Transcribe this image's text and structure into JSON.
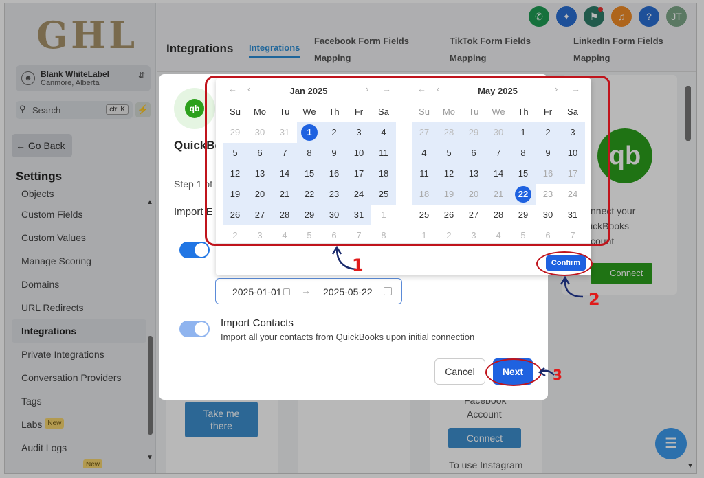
{
  "sidebar": {
    "logo": "GHL",
    "account_name": "Blank WhiteLabel",
    "account_location": "Canmore, Alberta",
    "search_label": "Search",
    "search_shortcut": "ctrl K",
    "go_back": "Go Back",
    "settings_title": "Settings",
    "items": [
      {
        "label": "Objects"
      },
      {
        "label": "Custom Fields"
      },
      {
        "label": "Custom Values"
      },
      {
        "label": "Manage Scoring"
      },
      {
        "label": "Domains"
      },
      {
        "label": "URL Redirects"
      },
      {
        "label": "Integrations"
      },
      {
        "label": "Private Integrations"
      },
      {
        "label": "Conversation Providers"
      },
      {
        "label": "Tags"
      },
      {
        "label": "Labs",
        "badge": "New"
      },
      {
        "label": "Audit Logs"
      }
    ],
    "bottom_badge": "New"
  },
  "header": {
    "title": "Integrations",
    "tabs": [
      {
        "label": "Integrations"
      },
      {
        "label_line1": "Facebook Form Fields",
        "label_line2": "Mapping"
      },
      {
        "label_line1": "TikTok Form Fields",
        "label_line2": "Mapping"
      },
      {
        "label_line1": "LinkedIn Form Fields",
        "label_line2": "Mapping"
      }
    ],
    "avatar_initials": "JT",
    "help_glyph": "?",
    "icons": [
      "phone-icon",
      "sparkle-icon",
      "megaphone-icon",
      "bell-icon",
      "help-icon",
      "avatar"
    ]
  },
  "background": {
    "qb_text_1": "nnect your",
    "qb_text_2": "ickBooks",
    "qb_text_3": "count",
    "connect_label": "Connect",
    "take_me_1": "Take me",
    "take_me_2": "there",
    "fb_text_1": "Facebook",
    "fb_text_2": "Account",
    "connect_label_2": "Connect",
    "instagram_text": "To use Instagram"
  },
  "modal": {
    "title": "QuickBo",
    "step": "Step 1 of",
    "import_label": "Import E",
    "date_start": "2025-01-01",
    "date_end": "2025-05-22",
    "import_contacts_title": "Import Contacts",
    "import_contacts_desc": "Import all your contacts from QuickBooks upon initial connection",
    "cancel": "Cancel",
    "next": "Next"
  },
  "calendar": {
    "weekdays": [
      "Su",
      "Mo",
      "Tu",
      "We",
      "Th",
      "Fr",
      "Sa"
    ],
    "left": {
      "title": "Jan 2025",
      "weeks": [
        [
          "29",
          "30",
          "31",
          "1",
          "2",
          "3",
          "4"
        ],
        [
          "5",
          "6",
          "7",
          "8",
          "9",
          "10",
          "11"
        ],
        [
          "12",
          "13",
          "14",
          "15",
          "16",
          "17",
          "18"
        ],
        [
          "19",
          "20",
          "21",
          "22",
          "23",
          "24",
          "25"
        ],
        [
          "26",
          "27",
          "28",
          "29",
          "30",
          "31",
          "1"
        ],
        [
          "2",
          "3",
          "4",
          "5",
          "6",
          "7",
          "8"
        ]
      ]
    },
    "right": {
      "title": "May 2025",
      "weeks": [
        [
          "27",
          "28",
          "29",
          "30",
          "1",
          "2",
          "3"
        ],
        [
          "4",
          "5",
          "6",
          "7",
          "8",
          "9",
          "10"
        ],
        [
          "11",
          "12",
          "13",
          "14",
          "15",
          "16",
          "17"
        ],
        [
          "18",
          "19",
          "20",
          "21",
          "22",
          "23",
          "24"
        ],
        [
          "25",
          "26",
          "27",
          "28",
          "29",
          "30",
          "31"
        ],
        [
          "1",
          "2",
          "3",
          "4",
          "5",
          "6",
          "7"
        ]
      ]
    },
    "confirm": "Confirm"
  },
  "annotations": [
    "1",
    "2",
    "3"
  ],
  "colors": {
    "accent": "#1f62e0",
    "annotation": "#c0141c",
    "quickbooks": "#2ca01c",
    "logo": "#a8946b"
  }
}
